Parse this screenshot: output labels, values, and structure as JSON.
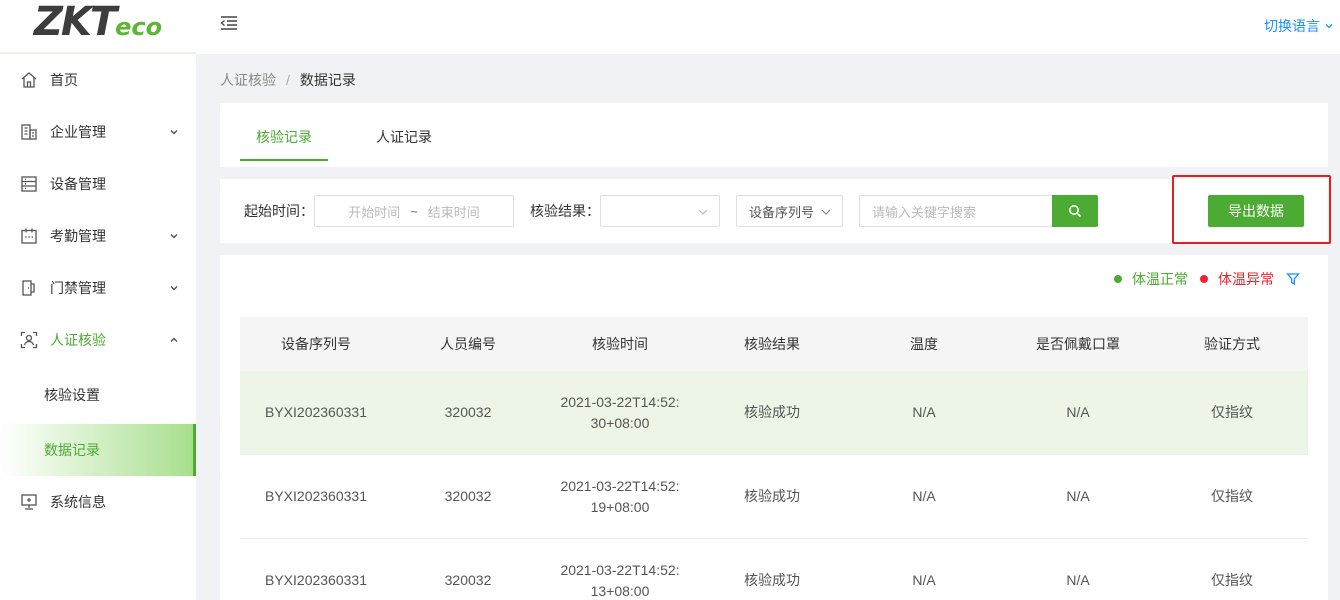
{
  "logo": {
    "main": "ZKT",
    "eco": "eco"
  },
  "header": {
    "language": "切换语言"
  },
  "sidebar": {
    "items": [
      {
        "label": "首页"
      },
      {
        "label": "企业管理"
      },
      {
        "label": "设备管理"
      },
      {
        "label": "考勤管理"
      },
      {
        "label": "门禁管理"
      },
      {
        "label": "人证核验"
      },
      {
        "label": "核验设置"
      },
      {
        "label": "数据记录"
      },
      {
        "label": "系统信息"
      }
    ]
  },
  "breadcrumb": {
    "parent": "人证核验",
    "separator": "/",
    "current": "数据记录"
  },
  "tabs": [
    {
      "label": "核验记录"
    },
    {
      "label": "人证记录"
    }
  ],
  "filters": {
    "start_label": "起始时间：",
    "start_placeholder": "开始时间",
    "tilde": "~",
    "end_placeholder": "结束时间",
    "result_label": "核验结果：",
    "result_value": "",
    "device_select": "设备序列号",
    "search_placeholder": "请输入关键字搜索",
    "export_label": "导出数据"
  },
  "legend": {
    "normal": "体温正常",
    "abnormal": "体温异常",
    "normal_color": "#4cab32",
    "abnormal_color": "#f5222d"
  },
  "table": {
    "columns": [
      "设备序列号",
      "人员编号",
      "核验时间",
      "核验结果",
      "温度",
      "是否佩戴口罩",
      "验证方式"
    ],
    "rows": [
      [
        "BYXI202360331",
        "320032",
        "2021-03-22T14:52:30+08:00",
        "核验成功",
        "N/A",
        "N/A",
        "仅指纹"
      ],
      [
        "BYXI202360331",
        "320032",
        "2021-03-22T14:52:19+08:00",
        "核验成功",
        "N/A",
        "N/A",
        "仅指纹"
      ],
      [
        "BYXI202360331",
        "320032",
        "2021-03-22T14:52:13+08:00",
        "核验成功",
        "N/A",
        "N/A",
        "仅指纹"
      ]
    ]
  },
  "colors": {
    "accent": "#4cab32",
    "highlight": "#e02020",
    "link": "#1890ff"
  }
}
